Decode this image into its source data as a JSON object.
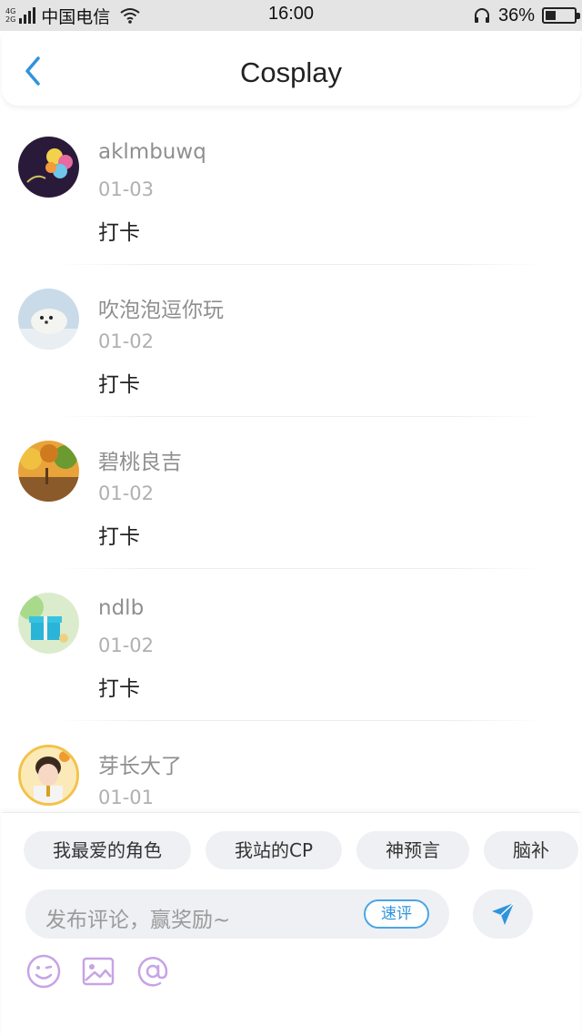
{
  "status_bar": {
    "net_top": "4G",
    "net_bottom": "2G",
    "carrier": "中国电信",
    "time": "16:00",
    "battery_percent_text": "36%",
    "battery_level": 0.36
  },
  "header": {
    "title": "Cosplay"
  },
  "comments": [
    {
      "user": "aklmbuwq",
      "date": "01-03",
      "text": "打卡"
    },
    {
      "user": "吹泡泡逗你玩",
      "date": "01-02",
      "text": "打卡"
    },
    {
      "user": "碧桃良吉",
      "date": "01-02",
      "text": "打卡"
    },
    {
      "user": "ndlb",
      "date": "01-02",
      "text": "打卡"
    },
    {
      "user": "芽长大了",
      "date": "01-01",
      "text": ""
    }
  ],
  "quick_tags": [
    "我最爱的角色",
    "我站的CP",
    "神预言",
    "脑补"
  ],
  "composer": {
    "placeholder": "发布评论，赢奖励~",
    "quick_review_label": "速评"
  },
  "colors": {
    "accent": "#2f94dc",
    "tool_icon": "#c7a3e6",
    "chip_bg": "#eef0f3"
  }
}
